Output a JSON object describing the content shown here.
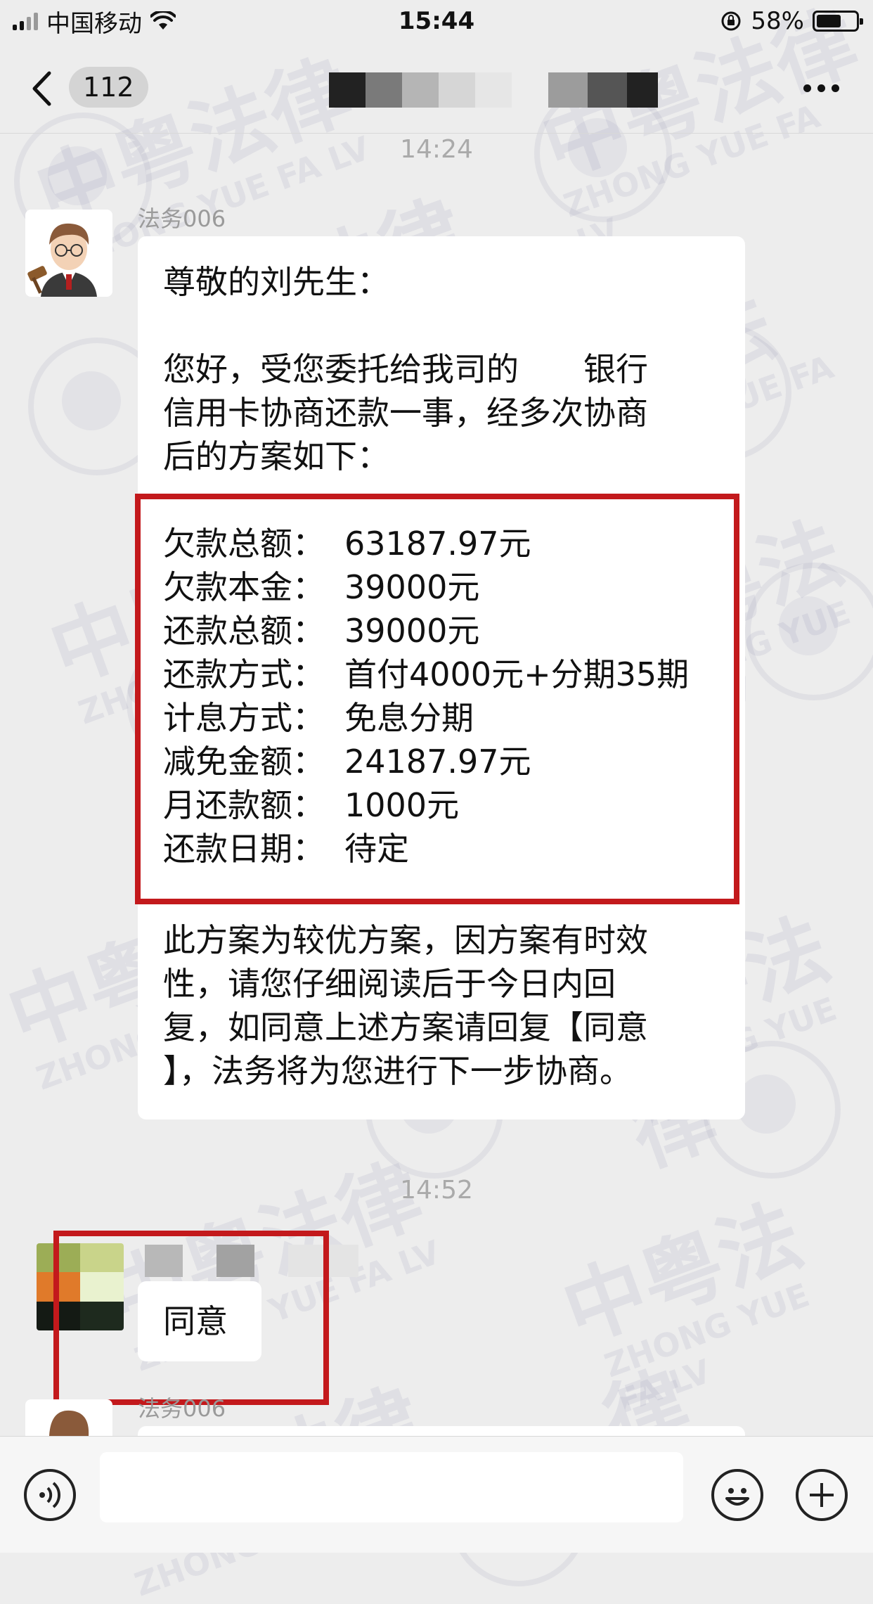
{
  "status_bar": {
    "carrier": "中国移动",
    "time": "15:44",
    "battery": "58%"
  },
  "nav": {
    "unread_count": "112"
  },
  "timestamps": [
    "14:24",
    "14:52"
  ],
  "message1": {
    "sender": "法务006",
    "greeting": "尊敬的刘先生：",
    "intro_lines": [
      "您好，受您委托给我司的　　银行",
      "信用卡协商还款一事，经多次协商",
      "后的方案如下："
    ],
    "plan": [
      {
        "label": "欠款总额：",
        "value": "63187.97元"
      },
      {
        "label": "欠款本金：",
        "value": "39000元"
      },
      {
        "label": "还款总额：",
        "value": "39000元"
      },
      {
        "label": "还款方式：",
        "value": "首付4000元+分期35期"
      },
      {
        "label": "计息方式：",
        "value": "免息分期"
      },
      {
        "label": "减免金额：",
        "value": "24187.97元"
      },
      {
        "label": "月还款额：",
        "value": "1000元"
      },
      {
        "label": "还款日期：",
        "value": "待定"
      }
    ],
    "closing_lines": [
      "此方案为较优方案，因方案有时效",
      "性，请您仔细阅读后于今日内回",
      "复，如同意上述方案请回复【同意",
      "】，法务将为您进行下一步协商。"
    ]
  },
  "message2": {
    "text": "同意"
  },
  "message3": {
    "sender": "法务006"
  },
  "watermark": {
    "cn": "中粤法律",
    "en": "ZHONG YUE FA LV",
    "seal_char": "中"
  },
  "colors": {
    "background": "#ededed",
    "bubble": "#ffffff",
    "highlight": "#c3191c"
  },
  "icons": {
    "back": "chevron-left-icon",
    "more": "more-dots-icon",
    "voice": "voice-icon",
    "emoji": "emoji-icon",
    "add": "plus-icon"
  }
}
